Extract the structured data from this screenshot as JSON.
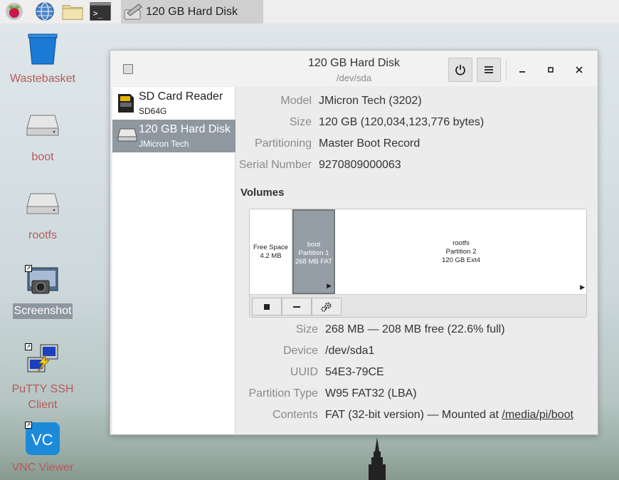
{
  "taskbar": {
    "launchers": [
      "raspberry-menu",
      "web-browser",
      "file-manager",
      "terminal"
    ],
    "active_task_label": "120 GB Hard Disk"
  },
  "desktop": {
    "icons": [
      {
        "label": "Wastebasket"
      },
      {
        "label": "boot"
      },
      {
        "label": "rootfs"
      },
      {
        "label": "Screenshot"
      },
      {
        "label": "PuTTY SSH Client"
      },
      {
        "label": "VNC Viewer"
      }
    ]
  },
  "window": {
    "title": "120 GB Hard Disk",
    "subtitle": "/dev/sda"
  },
  "sidebar": {
    "items": [
      {
        "name": "SD Card Reader",
        "sub": "SD64G"
      },
      {
        "name": "120 GB Hard Disk",
        "sub": "JMicron Tech"
      }
    ]
  },
  "drive": {
    "fields": [
      {
        "key": "Model",
        "value": "JMicron Tech (3202)"
      },
      {
        "key": "Size",
        "value": "120 GB (120,034,123,776 bytes)"
      },
      {
        "key": "Partitioning",
        "value": "Master Boot Record"
      },
      {
        "key": "Serial Number",
        "value": "9270809000063"
      }
    ]
  },
  "volumes": {
    "title": "Volumes",
    "segments": [
      {
        "line1": "Free Space",
        "line2": "4.2 MB",
        "line3": ""
      },
      {
        "line1": "boot",
        "line2": "Partition 1",
        "line3": "268 MB FAT"
      },
      {
        "line1": "rootfs",
        "line2": "Partition 2",
        "line3": "120 GB Ext4"
      }
    ]
  },
  "partition": {
    "fields": [
      {
        "key": "Size",
        "value": "268 MB — 208 MB free (22.6% full)"
      },
      {
        "key": "Device",
        "value": "/dev/sda1"
      },
      {
        "key": "UUID",
        "value": "54E3-79CE"
      },
      {
        "key": "Partition Type",
        "value": "W95 FAT32 (LBA)"
      },
      {
        "key": "Contents",
        "value": "FAT (32-bit version) — Mounted at ",
        "link": "/media/pi/boot"
      }
    ]
  }
}
